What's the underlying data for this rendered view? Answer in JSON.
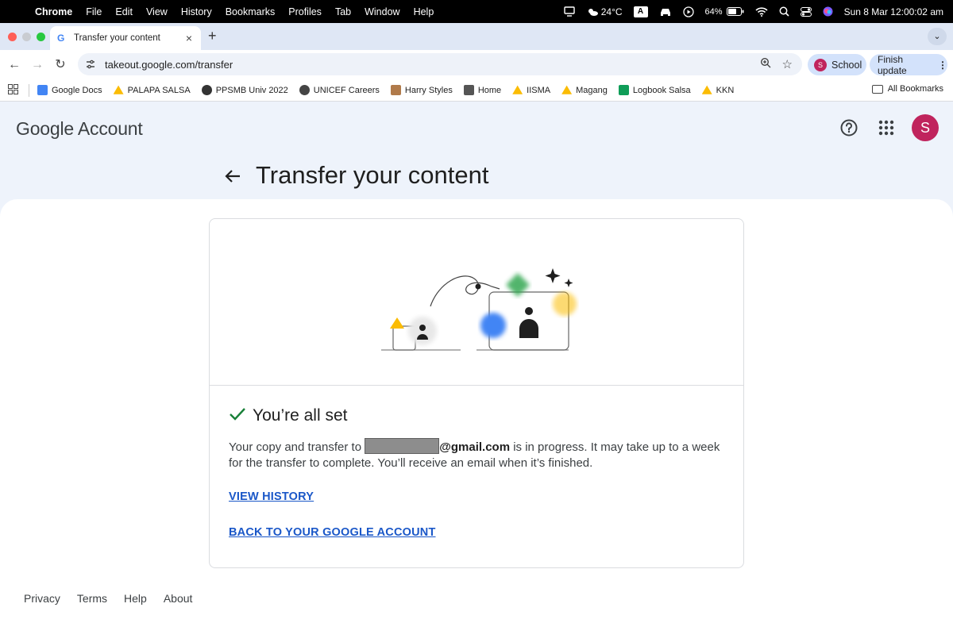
{
  "menubar": {
    "items": [
      "Chrome",
      "File",
      "Edit",
      "View",
      "History",
      "Bookmarks",
      "Profiles",
      "Tab",
      "Window",
      "Help"
    ],
    "weather": "24°C",
    "input_source": "A",
    "battery": "64%",
    "datetime": "Sun 8 Mar  12:00:02 am"
  },
  "tab": {
    "title": "Transfer your content"
  },
  "toolbar": {
    "url": "takeout.google.com/transfer",
    "profile_label": "School",
    "profile_initial": "S",
    "update_label": "Finish update"
  },
  "bookmarks": {
    "items": [
      {
        "label": "Google Docs",
        "icon": "docs-icon",
        "color": "#4285f4"
      },
      {
        "label": "PALAPA SALSA",
        "icon": "drive-icon",
        "color": "#fbbc04"
      },
      {
        "label": "PPSMB Univ 2022",
        "icon": "ppsmb-icon",
        "color": "#333333"
      },
      {
        "label": "UNICEF Careers",
        "icon": "globe-icon",
        "color": "#444444"
      },
      {
        "label": "Harry Styles",
        "icon": "photo-icon",
        "color": "#b07a4a"
      },
      {
        "label": "Home",
        "icon": "home-site-icon",
        "color": "#555555"
      },
      {
        "label": "IISMA",
        "icon": "drive-icon",
        "color": "#fbbc04"
      },
      {
        "label": "Magang",
        "icon": "drive-icon",
        "color": "#fbbc04"
      },
      {
        "label": "Logbook Salsa",
        "icon": "sheets-icon",
        "color": "#0f9d58"
      },
      {
        "label": "KKN",
        "icon": "drive-icon",
        "color": "#fbbc04"
      }
    ],
    "all_label": "All Bookmarks"
  },
  "header": {
    "logo_text": "Google Account",
    "avatar_initial": "S",
    "page_title": "Transfer your content"
  },
  "card": {
    "status": "You’re all set",
    "message_before": "Your copy and transfer to ",
    "email_domain": "@gmail.com",
    "message_after": " is in progress. It may take up to a week for the transfer to complete. You’ll receive an email when it’s finished.",
    "link_history": "VIEW HISTORY",
    "link_back": "BACK TO YOUR GOOGLE ACCOUNT"
  },
  "footer": {
    "links": [
      "Privacy",
      "Terms",
      "Help",
      "About"
    ]
  },
  "colors": {
    "accent": "#1a57c8",
    "check": "#188038",
    "avatar": "#c0245d"
  }
}
